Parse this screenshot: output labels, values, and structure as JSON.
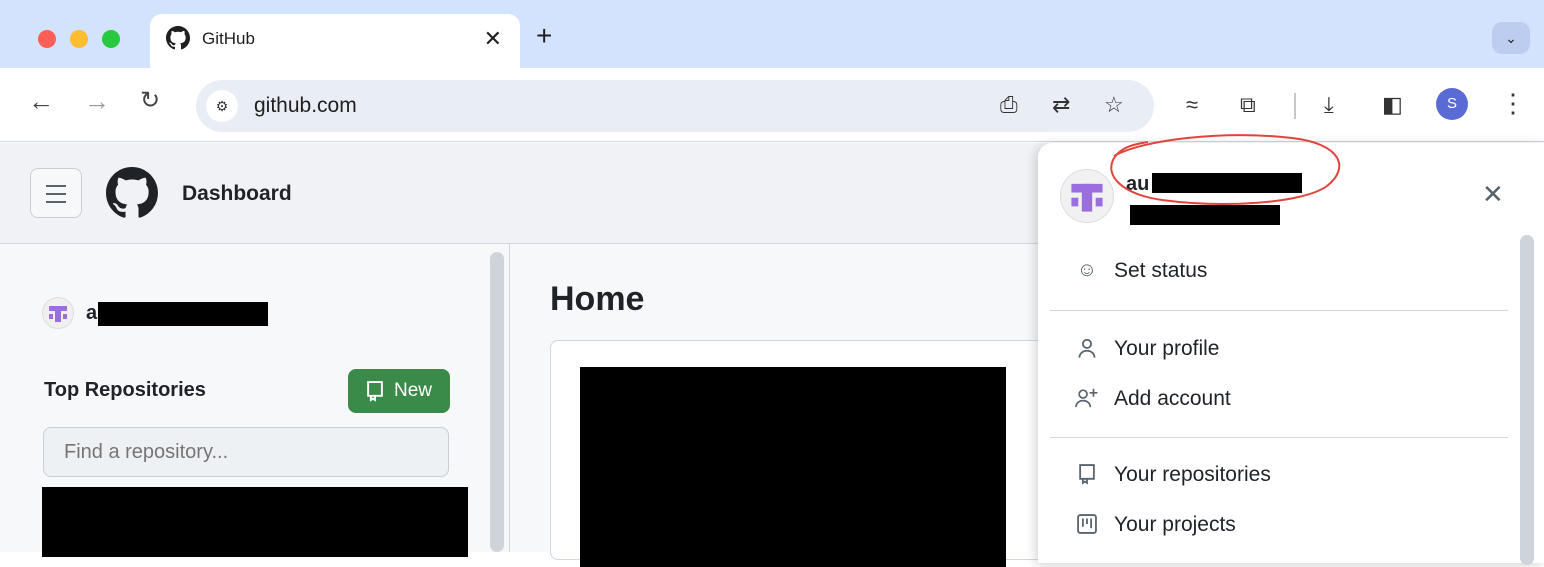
{
  "browser": {
    "tab_title": "GitHub",
    "url": "github.com",
    "profile_initial": "S",
    "traffic_colors": [
      "#ff5f57",
      "#febc2e",
      "#28c840"
    ]
  },
  "github": {
    "header_title": "Dashboard",
    "sidebar_user_visible": "a",
    "top_repositories_label": "Top Repositories",
    "new_button_label": "New",
    "find_placeholder": "Find a repository...",
    "home_heading": "Home"
  },
  "user_menu": {
    "username_visible": "au",
    "items": [
      {
        "label": "Set status",
        "icon": "smiley-icon"
      },
      {
        "label": "Your profile",
        "icon": "person-icon"
      },
      {
        "label": "Add account",
        "icon": "person-add-icon"
      },
      {
        "label": "Your repositories",
        "icon": "repo-icon"
      },
      {
        "label": "Your projects",
        "icon": "project-icon"
      }
    ]
  },
  "colors": {
    "accent_green": "#3a8a4a",
    "annotation_red": "#e0443c"
  }
}
